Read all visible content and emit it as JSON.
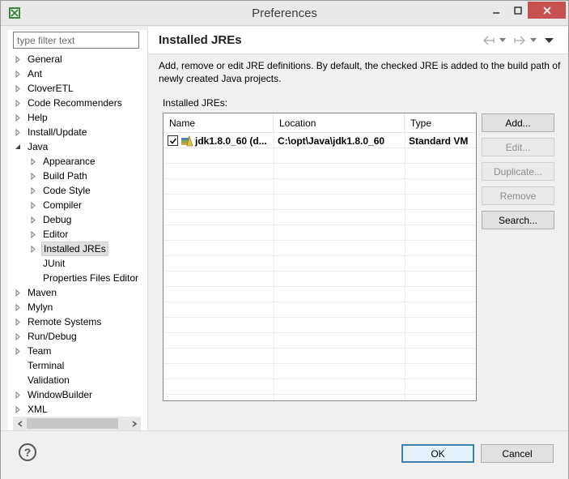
{
  "window": {
    "title": "Preferences"
  },
  "filter": {
    "placeholder": "type filter text"
  },
  "tree": [
    {
      "label": "General",
      "expandable": true
    },
    {
      "label": "Ant",
      "expandable": true
    },
    {
      "label": "CloverETL",
      "expandable": true
    },
    {
      "label": "Code Recommenders",
      "expandable": true
    },
    {
      "label": "Help",
      "expandable": true
    },
    {
      "label": "Install/Update",
      "expandable": true
    },
    {
      "label": "Java",
      "expandable": true,
      "expanded": true
    },
    {
      "label": "Appearance",
      "expandable": true,
      "child": true
    },
    {
      "label": "Build Path",
      "expandable": true,
      "child": true
    },
    {
      "label": "Code Style",
      "expandable": true,
      "child": true
    },
    {
      "label": "Compiler",
      "expandable": true,
      "child": true
    },
    {
      "label": "Debug",
      "expandable": true,
      "child": true
    },
    {
      "label": "Editor",
      "expandable": true,
      "child": true
    },
    {
      "label": "Installed JREs",
      "expandable": true,
      "child": true,
      "selected": true
    },
    {
      "label": "JUnit",
      "expandable": false,
      "child": true
    },
    {
      "label": "Properties Files Editor",
      "expandable": false,
      "child": true
    },
    {
      "label": "Maven",
      "expandable": true
    },
    {
      "label": "Mylyn",
      "expandable": true
    },
    {
      "label": "Remote Systems",
      "expandable": true
    },
    {
      "label": "Run/Debug",
      "expandable": true
    },
    {
      "label": "Team",
      "expandable": true
    },
    {
      "label": "Terminal",
      "expandable": false
    },
    {
      "label": "Validation",
      "expandable": false
    },
    {
      "label": "WindowBuilder",
      "expandable": true
    },
    {
      "label": "XML",
      "expandable": true
    }
  ],
  "page": {
    "title": "Installed JREs",
    "description": "Add, remove or edit JRE definitions. By default, the checked JRE is added to the build path of newly created Java projects.",
    "section_label": "Installed JREs:"
  },
  "table": {
    "columns": [
      "Name",
      "Location",
      "Type"
    ],
    "rows": [
      {
        "checked": true,
        "name": "jdk1.8.0_60 (d...",
        "location": "C:\\opt\\Java\\jdk1.8.0_60",
        "type": "Standard VM"
      }
    ]
  },
  "side_buttons": {
    "add": "Add...",
    "edit": "Edit...",
    "duplicate": "Duplicate...",
    "remove": "Remove",
    "search": "Search..."
  },
  "dialog": {
    "help": "?",
    "ok": "OK",
    "cancel": "Cancel"
  }
}
